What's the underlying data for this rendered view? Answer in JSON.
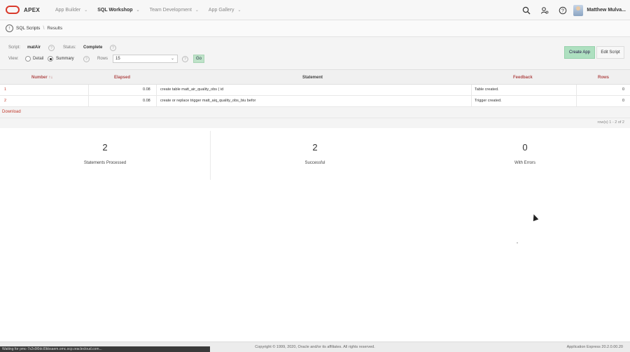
{
  "topbar": {
    "brand": "APEX",
    "nav": [
      {
        "label": "App Builder"
      },
      {
        "label": "SQL Workshop"
      },
      {
        "label": "Team Development"
      },
      {
        "label": "App Gallery"
      }
    ],
    "user_name": "Matthew Mulva..."
  },
  "breadcrumb": {
    "items": [
      "SQL Scripts",
      "Results"
    ]
  },
  "filters": {
    "script_label": "Script:",
    "script_value": "matAir",
    "status_label": "Status:",
    "status_value": "Complete",
    "view_label": "View:",
    "view_detail": "Detail",
    "view_summary": "Summary",
    "rows_label": "Rows",
    "rows_value": "15",
    "go_label": "Go",
    "help_glyph": "?"
  },
  "actions": {
    "create_app": "Create App",
    "edit_script": "Edit Script"
  },
  "table": {
    "headers": {
      "number": "Number",
      "elapsed": "Elapsed",
      "statement": "Statement",
      "feedback": "Feedback",
      "rows": "Rows"
    },
    "rows": [
      {
        "number": "1",
        "elapsed": "0.08",
        "statement": "create table matt_air_quality_obs ( id",
        "feedback": "Table created.",
        "rows": "0"
      },
      {
        "number": "2",
        "elapsed": "0.08",
        "statement": "create or replace trigger matt_aiq_quality_obs_biu befor",
        "feedback": "Trigger created.",
        "rows": "0"
      }
    ],
    "download": "Download",
    "pagination": "row(s) 1 - 2 of 2"
  },
  "stats": [
    {
      "value": "2",
      "caption": "Statements Processed"
    },
    {
      "value": "2",
      "caption": "Successful"
    },
    {
      "value": "0",
      "caption": "With Errors"
    }
  ],
  "footer": {
    "copyright": "Copyright © 1999, 2020, Oracle and/or its affiliates. All rights reserved.",
    "version": "Application Express 20.2.0.00.20",
    "status_text": "Waiting for pmc-7s2x9l0dcl0bbsaem.omc.ocp.oraclecloud.com..."
  },
  "colors": {
    "brand_red": "#d93a2b",
    "accent_green": "#aee0c0",
    "link_red": "#c0392b"
  }
}
